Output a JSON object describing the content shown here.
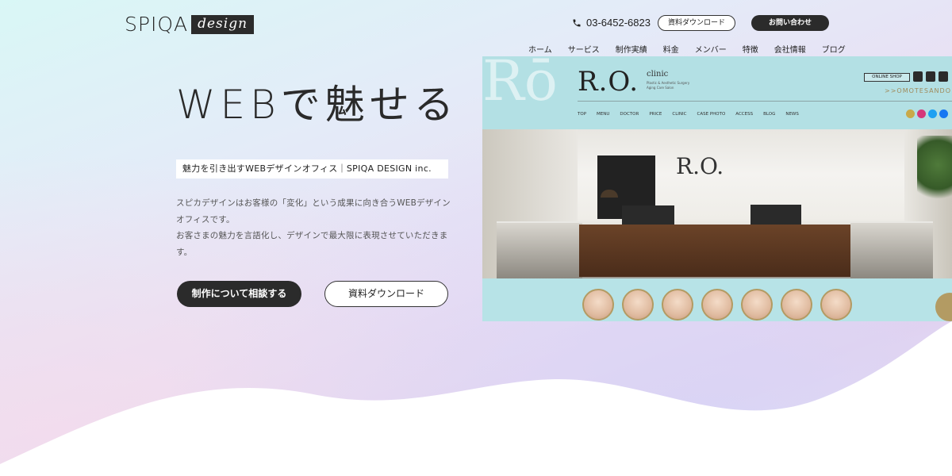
{
  "header": {
    "logo_text": "SPIQA",
    "logo_script": "design",
    "phone": "03-6452-6823",
    "download_label": "資料ダウンロード",
    "contact_label": "お問い合わせ"
  },
  "nav": {
    "items": [
      {
        "label": "ホーム"
      },
      {
        "label": "サービス"
      },
      {
        "label": "制作実績"
      },
      {
        "label": "料金"
      },
      {
        "label": "メンバー"
      },
      {
        "label": "特徴"
      },
      {
        "label": "会社情報"
      },
      {
        "label": "ブログ"
      }
    ]
  },
  "hero": {
    "title": "WEBで魅せる",
    "tagline": "魅力を引き出すWEBデザインオフィス｜SPIQA DESIGN inc.",
    "desc_line1": "スピカデザインはお客様の「変化」という成果に向き合うWEBデザインオフィスです。",
    "desc_line2": "お客さまの魅力を言語化し、デザインで最大限に表現させていただきます。",
    "consult_label": "制作について相談する",
    "download_label": "資料ダウンロード"
  },
  "showcase": {
    "deco": "Rō",
    "brand": "R.O.",
    "clinic": "clinic",
    "sub_line1": "Plastic & Aesthetic Surgery",
    "sub_line2": "Aging Care Salon",
    "shop_label": "ONLINE SHOP",
    "location": ">>OMOTESANDO TO",
    "menu": [
      "TOP",
      "MENU",
      "DOCTOR",
      "PRICE",
      "CLINIC",
      "CASE PHOTO",
      "ACCESS",
      "BLOG",
      "NEWS"
    ],
    "room_logo": "R.O."
  },
  "colors": {
    "dark": "#2b2b2b",
    "gold": "#b39b63",
    "teal_panel": "#b3e0e4"
  }
}
